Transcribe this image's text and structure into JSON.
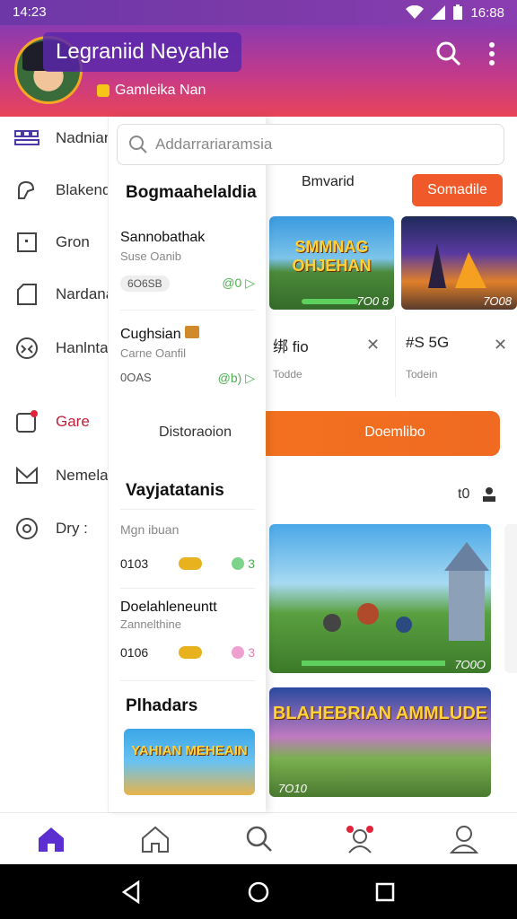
{
  "status": {
    "time": "14:23",
    "battery": "16:88"
  },
  "header": {
    "title": "Legraniid Neyahle",
    "subtitle": "Gamleika Nan"
  },
  "search": {
    "placeholder": "Addarrariaramsia"
  },
  "sidebar": {
    "items": [
      {
        "label": "Nadnian",
        "icon": "grid-icon"
      },
      {
        "label": "Blakend",
        "icon": "puzzle-icon"
      },
      {
        "label": "Gron",
        "icon": "frame-icon"
      },
      {
        "label": "Nardana",
        "icon": "tag-icon"
      },
      {
        "label": "Hanlnta",
        "icon": "globe-icon"
      },
      {
        "label": "Gare",
        "icon": "notification-icon"
      },
      {
        "label": "Nemela",
        "icon": "mail-icon"
      },
      {
        "label": "Dry :",
        "icon": "settings-icon"
      }
    ]
  },
  "drawer": {
    "section1_title": "Bogmaahelaldia",
    "item1": {
      "title": "Sannobathak",
      "sub": "Suse Oanib",
      "pill": "6O6SB",
      "rating": "@0 ▷"
    },
    "item2": {
      "title": "Cughsian",
      "sub": "Carne Oanfil",
      "count": "0OAS",
      "rating": "@b) ▷"
    },
    "section2_title": "Vayjatatanis",
    "item3": {
      "title": "Mgn ibuan",
      "count": "0103",
      "rating": "3"
    },
    "item4": {
      "title": "Doelahleneuntt",
      "sub": "Zannelthine",
      "count": "0106",
      "rating": "3"
    },
    "section3_title": "Plhadars",
    "thumb_label": "YAHIAN MEHEAIN"
  },
  "tabs": {
    "left": "Bmvarid",
    "right": "Somadile"
  },
  "games": {
    "g1": {
      "label": "SMMNAG OHJEHAN",
      "count": "7O0 8"
    },
    "g2": {
      "count": "7O08"
    },
    "stat1": {
      "value": "绑 fio",
      "sub": "Todde"
    },
    "stat2": {
      "value": "#S 5G",
      "sub": "Todein"
    },
    "big_button_left": "Distoraoion",
    "big_button_right": "Doemlibo",
    "section_right": "t0",
    "g3": {
      "count": "7O0O"
    },
    "g4": {
      "label": "BLAHEBRIAN AMMLUDE",
      "count": "7O10"
    }
  },
  "colors": {
    "accent": "#f05a2a",
    "header_start": "#8a3ab0",
    "header_end": "#e84458",
    "brand": "#5b2fd0"
  }
}
